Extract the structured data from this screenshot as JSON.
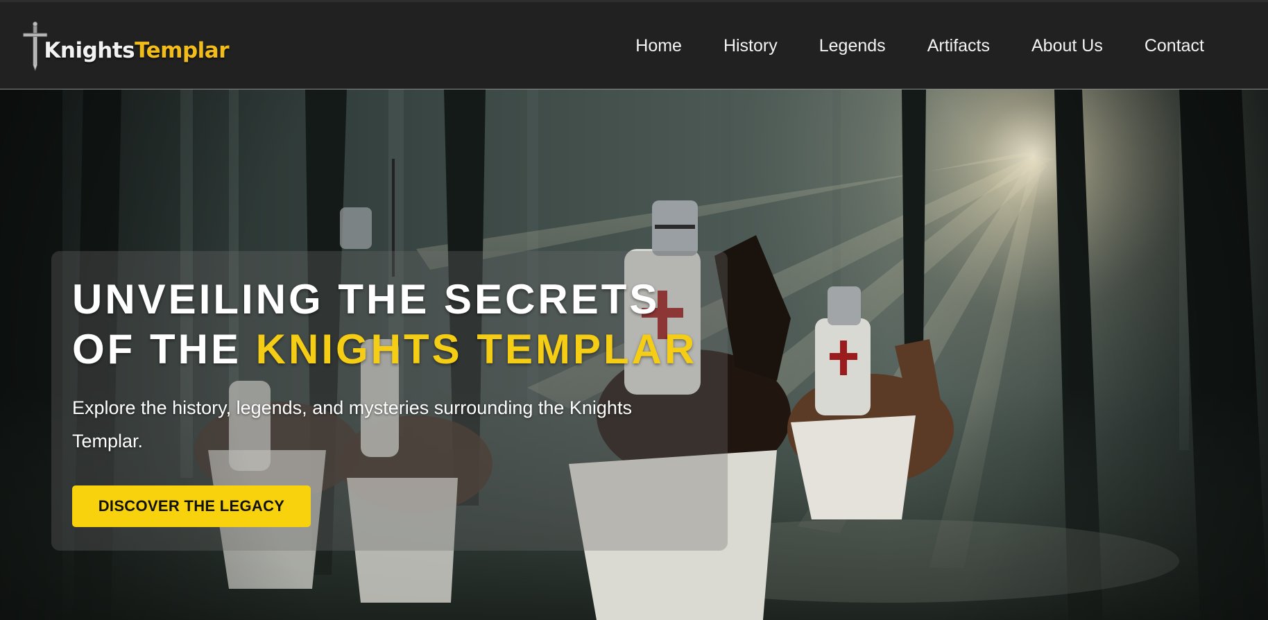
{
  "brand": {
    "logo_part1": "Knights",
    "logo_part2": "Templar",
    "accent_color": "#f5cd14",
    "logo_icon": "sword-icon"
  },
  "nav": {
    "items": [
      {
        "label": "Home"
      },
      {
        "label": "History"
      },
      {
        "label": "Legends"
      },
      {
        "label": "Artifacts"
      },
      {
        "label": "About Us"
      },
      {
        "label": "Contact"
      }
    ]
  },
  "hero": {
    "title_line1": "UNVEILING THE SECRETS",
    "title_line2_prefix": "OF THE ",
    "title_line2_accent": "KNIGHTS TEMPLAR",
    "subtitle": "Explore the history, legends, and mysteries surrounding the Knights Templar.",
    "cta_label": "DISCOVER THE LEGACY",
    "background_image": "knights-on-horseback-in-misty-forest"
  },
  "colors": {
    "header_bg": "#212121",
    "cta_bg": "#f7d20d",
    "title_accent": "#f5cd14",
    "logo_accent": "#f2bd1a"
  }
}
